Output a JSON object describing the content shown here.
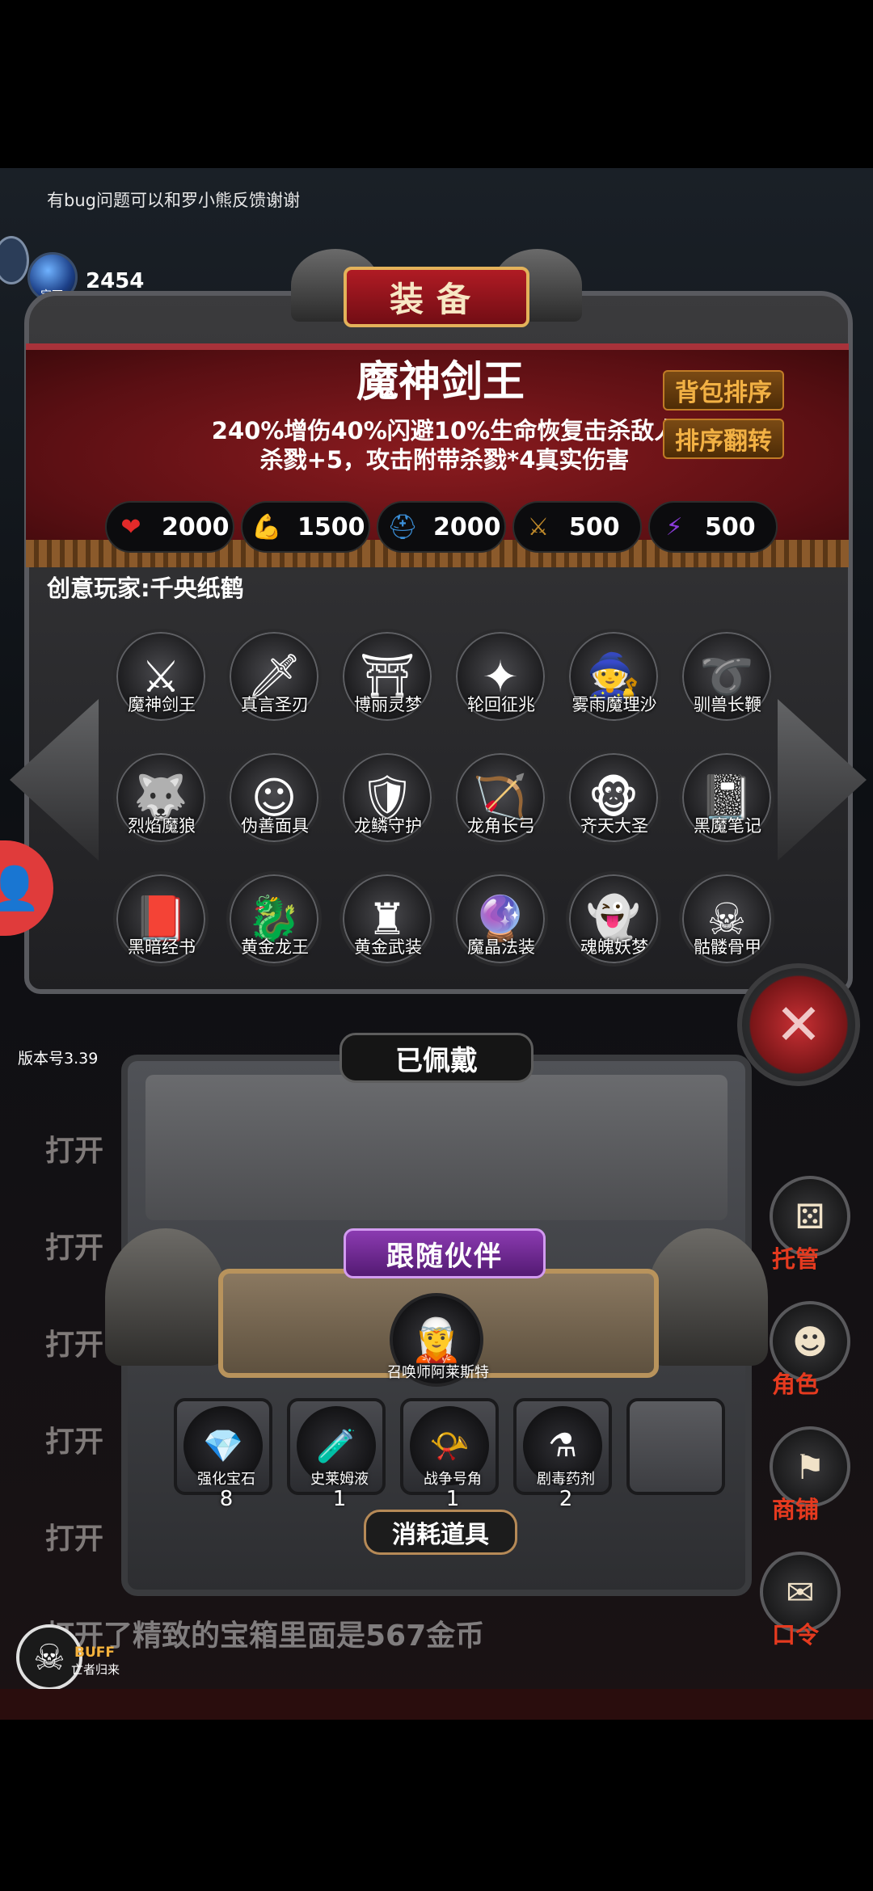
{
  "top_note": "有bug问题可以和罗小熊反馈谢谢",
  "currency": {
    "label": "宝石",
    "amount": "2454",
    "icon": "crystal-gem-icon"
  },
  "panel": {
    "title": "装备",
    "item_name": "魔神剑王",
    "item_desc_line1": "240%增伤40%闪避10%生命恢复击杀敌人",
    "item_desc_line2": "杀戮+5，攻击附带杀戮*4真实伤害",
    "sort_button": "背包排序",
    "reverse_button": "排序翻转",
    "creator": "创意玩家:千央纸鹤"
  },
  "stats": [
    {
      "icon": "heart-icon",
      "value": "2000",
      "color": "#e32a2a"
    },
    {
      "icon": "strength-icon",
      "value": "1500",
      "color": "#e0c020"
    },
    {
      "icon": "armor-icon",
      "value": "2000",
      "color": "#3b8fd8"
    },
    {
      "icon": "sword-icon",
      "value": "500",
      "color": "#c08a2a"
    },
    {
      "icon": "lightning-icon",
      "value": "500",
      "color": "#8a3bd8"
    }
  ],
  "items": [
    {
      "label": "魔神剑王",
      "icon": "⚔"
    },
    {
      "label": "真言圣刃",
      "icon": "🗡"
    },
    {
      "label": "博丽灵梦",
      "icon": "⛩"
    },
    {
      "label": "轮回征兆",
      "icon": "✦"
    },
    {
      "label": "雾雨魔理沙",
      "icon": "🧙"
    },
    {
      "label": "驯兽长鞭",
      "icon": "➰"
    },
    {
      "label": "烈焰魔狼",
      "icon": "🐺"
    },
    {
      "label": "伪善面具",
      "icon": "☺"
    },
    {
      "label": "龙鳞守护",
      "icon": "🛡"
    },
    {
      "label": "龙角长弓",
      "icon": "🏹"
    },
    {
      "label": "齐天大圣",
      "icon": "🐵"
    },
    {
      "label": "黑魔笔记",
      "icon": "📓"
    },
    {
      "label": "黑暗经书",
      "icon": "📕"
    },
    {
      "label": "黄金龙王",
      "icon": "🐉"
    },
    {
      "label": "黄金武装",
      "icon": "♜"
    },
    {
      "label": "魔晶法装",
      "icon": "🔮"
    },
    {
      "label": "魂魄妖梦",
      "icon": "👻"
    },
    {
      "label": "骷髅骨甲",
      "icon": "☠"
    }
  ],
  "version": "版本号3.39",
  "worn_label": "已佩戴",
  "companion_label": "跟随伙伴",
  "companion": {
    "label": "召唤师阿莱斯特",
    "icon": "🧝"
  },
  "consumables": [
    {
      "label": "强化宝石",
      "count": "8",
      "icon": "💎"
    },
    {
      "label": "史莱姆液",
      "count": "1",
      "icon": "🧪"
    },
    {
      "label": "战争号角",
      "count": "1",
      "icon": "📯"
    },
    {
      "label": "剧毒药剂",
      "count": "2",
      "icon": "⚗"
    }
  ],
  "consumables_label": "消耗道具",
  "log_prefix": "打开",
  "right_menu": [
    {
      "label": "托管",
      "icon": "dice-icon"
    },
    {
      "label": "角色",
      "icon": "hooded-figure-icon"
    },
    {
      "label": "商铺",
      "icon": "shop-icon"
    },
    {
      "label": "口令",
      "icon": "code-book-icon"
    }
  ],
  "bottom_log": "打开了精致的宝箱里面是567金币",
  "buff": {
    "label": "BUFF",
    "sub": "亡者归来"
  }
}
